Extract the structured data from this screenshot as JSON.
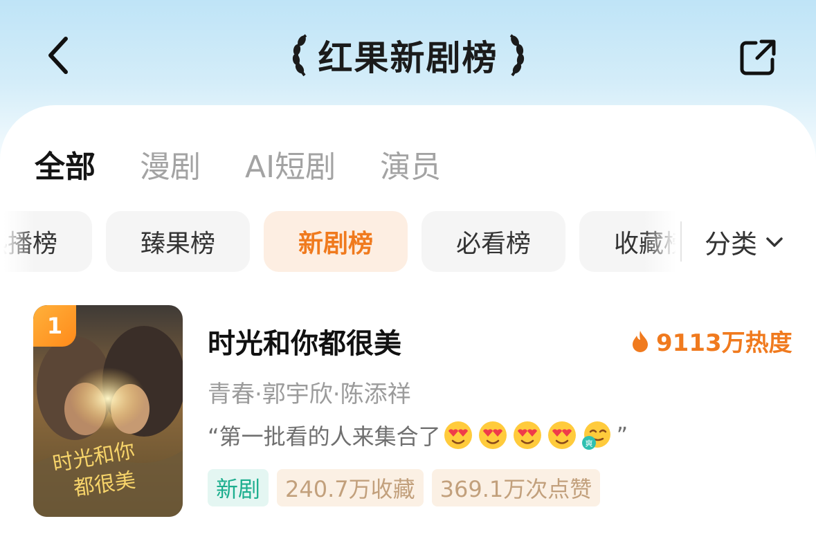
{
  "header": {
    "title": "红果新剧榜",
    "back_icon": "chevron-left-icon",
    "share_icon": "share-icon"
  },
  "tabs": [
    {
      "label": "全部",
      "active": true
    },
    {
      "label": "漫剧",
      "active": false
    },
    {
      "label": "AI短剧",
      "active": false
    },
    {
      "label": "演员",
      "active": false
    }
  ],
  "chips": [
    {
      "label": "热播榜",
      "active": false
    },
    {
      "label": "臻果榜",
      "active": false
    },
    {
      "label": "新剧榜",
      "active": true
    },
    {
      "label": "必看榜",
      "active": false
    },
    {
      "label": "收藏榜",
      "active": false
    }
  ],
  "category": {
    "label": "分类"
  },
  "items": [
    {
      "rank": "1",
      "title": "时光和你都很美",
      "heat": "9113万热度",
      "meta": "青春·郭宇欣·陈添祥",
      "quote_open": "“第一批看的人来集合了",
      "quote_close": "”",
      "emojis": [
        "heart-eyes-emoji",
        "heart-eyes-emoji",
        "heart-eyes-emoji",
        "heart-eyes-emoji",
        "shuang-emoji"
      ],
      "emoji_badge": "爽",
      "tags": {
        "new": "新剧",
        "collect": "240.7万收藏",
        "likes": "369.1万次点赞"
      },
      "poster_title": "时光和你都很美"
    }
  ],
  "colors": {
    "accent": "#f07a1e",
    "new_tag": "#1cae8e"
  }
}
